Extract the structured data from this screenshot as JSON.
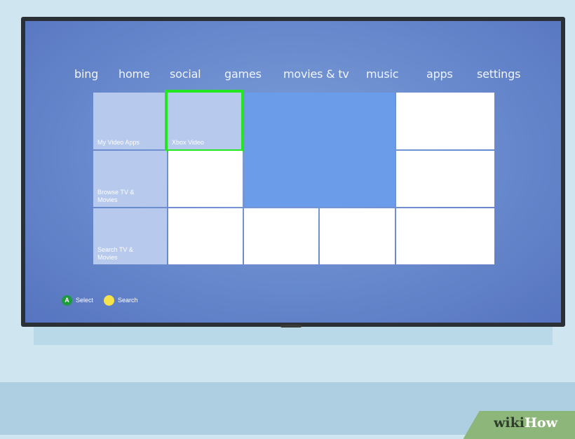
{
  "nav": {
    "items": [
      {
        "id": "bing",
        "label": "bing"
      },
      {
        "id": "home",
        "label": "home"
      },
      {
        "id": "social",
        "label": "social"
      },
      {
        "id": "games",
        "label": "games"
      },
      {
        "id": "movies-tv",
        "label": "movies & tv"
      },
      {
        "id": "music",
        "label": "music"
      },
      {
        "id": "apps",
        "label": "apps"
      },
      {
        "id": "settings",
        "label": "settings"
      }
    ]
  },
  "tiles": {
    "my_video_apps": "My Video Apps",
    "xbox_video": "Xbox Video",
    "browse_tv_movies": "Browse TV & Movies",
    "search_tv_movies": "Search TV & Movies"
  },
  "hints": {
    "select_button": "A",
    "select_label": "Select",
    "search_label": "Search"
  },
  "colors": {
    "accent_selected": "#22e620",
    "a_button": "#1f9a3e",
    "y_button": "#f6e24a",
    "screen_bg": "#6b8dcf"
  },
  "watermark": {
    "wiki": "wiki",
    "how": "How"
  }
}
